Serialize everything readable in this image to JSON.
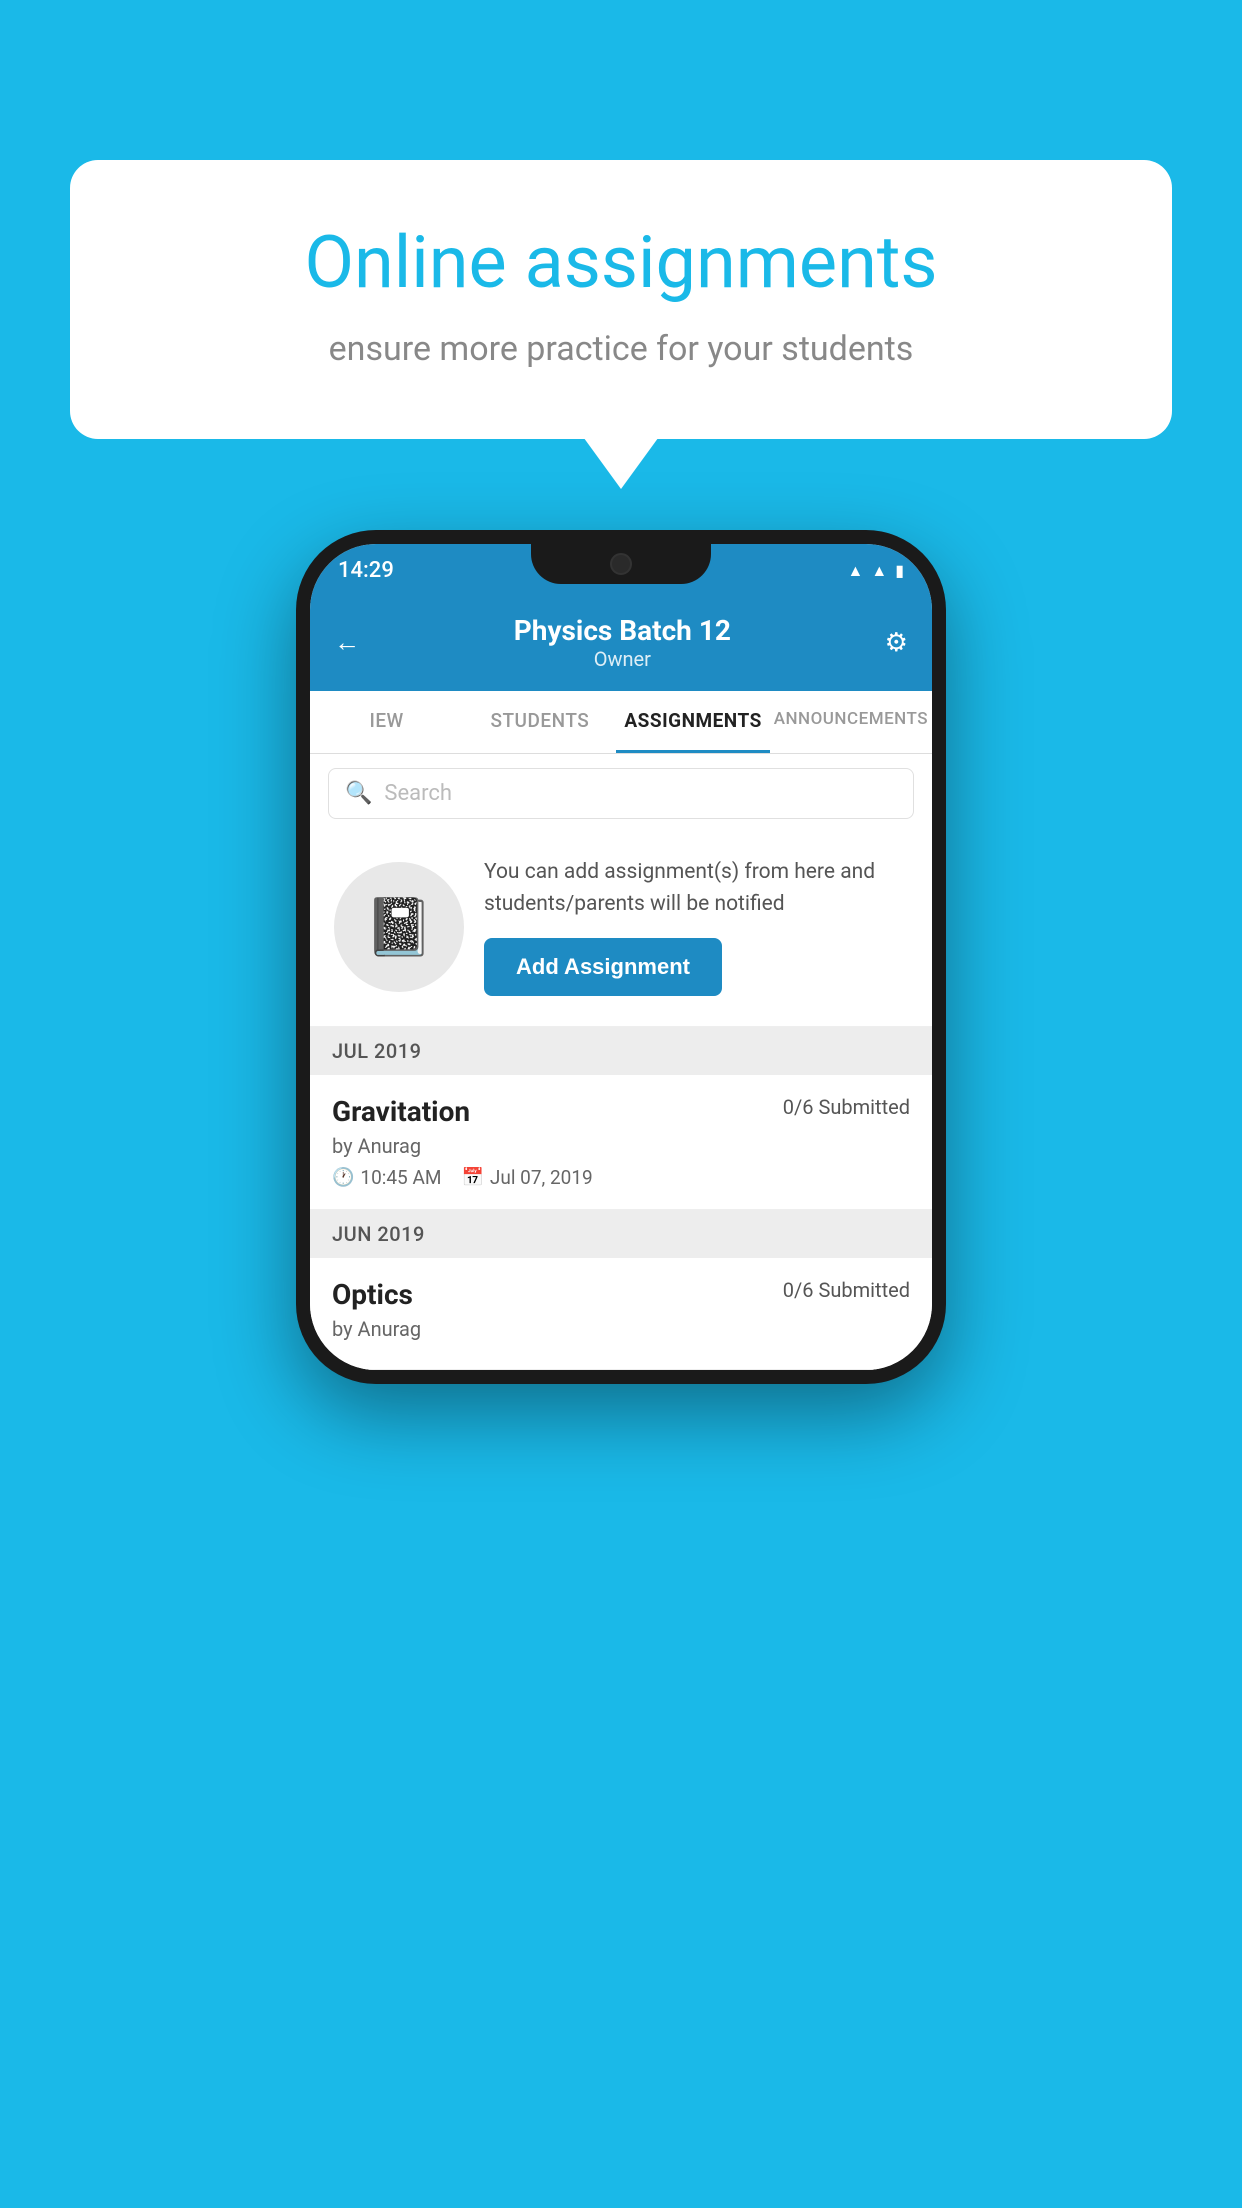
{
  "background_color": "#1ab9e8",
  "speech_bubble": {
    "title": "Online assignments",
    "subtitle": "ensure more practice for your students"
  },
  "status_bar": {
    "time": "14:29",
    "icons": [
      "wifi",
      "signal",
      "battery"
    ]
  },
  "header": {
    "title": "Physics Batch 12",
    "subtitle": "Owner",
    "back_label": "←",
    "settings_label": "⚙"
  },
  "tabs": [
    {
      "label": "IEW",
      "active": false
    },
    {
      "label": "STUDENTS",
      "active": false
    },
    {
      "label": "ASSIGNMENTS",
      "active": true
    },
    {
      "label": "ANNOUNCEMENTS",
      "active": false
    }
  ],
  "search": {
    "placeholder": "Search"
  },
  "promo": {
    "description": "You can add assignment(s) from here and students/parents will be notified",
    "button_label": "Add Assignment"
  },
  "sections": [
    {
      "month": "JUL 2019",
      "assignments": [
        {
          "name": "Gravitation",
          "submitted": "0/6 Submitted",
          "by": "by Anurag",
          "time": "10:45 AM",
          "date": "Jul 07, 2019"
        }
      ]
    },
    {
      "month": "JUN 2019",
      "assignments": [
        {
          "name": "Optics",
          "submitted": "0/6 Submitted",
          "by": "by Anurag",
          "time": "",
          "date": ""
        }
      ]
    }
  ]
}
